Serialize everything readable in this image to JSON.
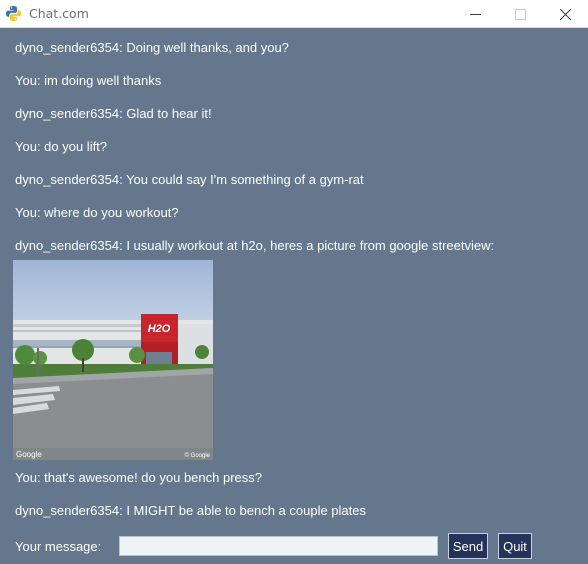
{
  "window": {
    "title": "Chat.com"
  },
  "messages": [
    {
      "text": "dyno_sender6354: Doing well thanks, and you?"
    },
    {
      "text": "You: im doing well thanks"
    },
    {
      "text": "dyno_sender6354: Glad to hear it!"
    },
    {
      "text": "You: do you lift?"
    },
    {
      "text": "dyno_sender6354: You could say I'm something of a gym-rat"
    },
    {
      "text": "You: where do you workout?"
    },
    {
      "text": "dyno_sender6354: I usually workout at h2o, heres a picture from google streetview:"
    },
    {
      "text": "You: that's awesome! do you bench press?"
    },
    {
      "text": "dyno_sender6354: I MIGHT be able to bench a couple plates"
    }
  ],
  "image": {
    "watermark_left": "Google",
    "watermark_right": "© Google",
    "sign_text": "H2O"
  },
  "composer": {
    "label": "Your message:",
    "value": "",
    "send_label": "Send",
    "quit_label": "Quit"
  },
  "colors": {
    "background": "#64778d",
    "button_bg": "#25335a",
    "input_bg": "#eef3f8",
    "text": "#ffffff"
  },
  "icons": {
    "app": "python-icon",
    "minimize": "minimize-icon",
    "maximize": "maximize-icon",
    "close": "close-icon"
  }
}
